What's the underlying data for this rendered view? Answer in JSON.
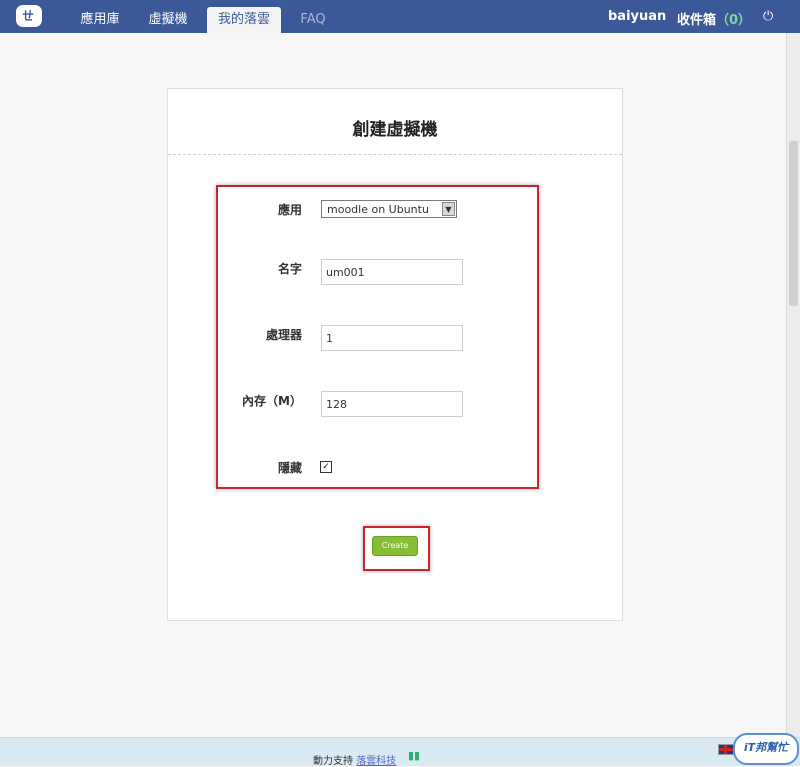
{
  "nav": {
    "tabs": [
      {
        "label": "應用庫"
      },
      {
        "label": "虛擬機"
      },
      {
        "label": "我的落雲"
      },
      {
        "label": "FAQ"
      }
    ],
    "user": "baiyuan",
    "inbox_label": "收件箱",
    "inbox_count": "（0）",
    "icons": {
      "logo": "cloud-logo-icon",
      "power": "power-icon"
    }
  },
  "form": {
    "title": "創建虛擬機",
    "app_label": "應用",
    "app_value": "moodle on Ubuntu",
    "name_label": "名字",
    "name_value": "um001",
    "cpu_label": "處理器",
    "cpu_value": "1",
    "mem_label": "內存（M）",
    "mem_value": "128",
    "hidden_label": "隱藏",
    "hidden_checked": true,
    "create_label": "Create"
  },
  "footer": {
    "powered_by": "動力支持",
    "company": "落雲科技",
    "watermark": "iT邦幫忙"
  },
  "colors": {
    "topbar": "#3b5998",
    "highlight": "#c9252b",
    "button": "#86be37",
    "footer": "#d9eaf2"
  }
}
